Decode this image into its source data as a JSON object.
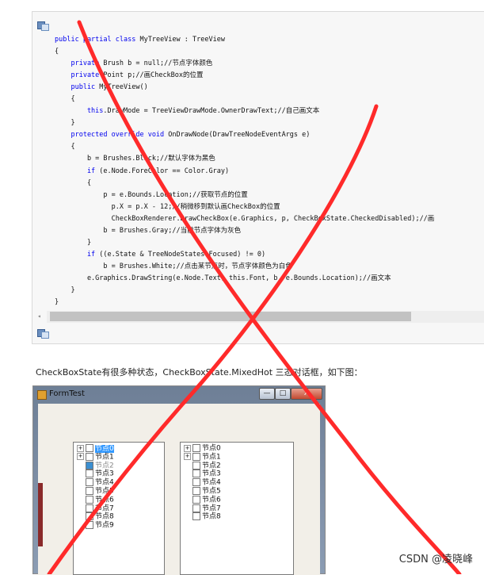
{
  "code_lines": [
    {
      "kw": "public partial class",
      "rest": " MyTreeView : TreeView"
    },
    {
      "kw": "",
      "rest": "{"
    },
    {
      "kw": "    private",
      "rest": " Brush b = null;//节点字体颜色"
    },
    {
      "kw": "    private",
      "rest": " Point p;//画CheckBox的位置"
    },
    {
      "kw": "    public",
      "rest": " MyTreeView()"
    },
    {
      "kw": "",
      "rest": "    {"
    },
    {
      "kw": "        this",
      "rest": ".DrawMode = TreeViewDrawMode.OwnerDrawText;//自己画文本"
    },
    {
      "kw": "",
      "rest": "    }"
    },
    {
      "kw": "    protected override void",
      "rest": " OnDrawNode(DrawTreeNodeEventArgs e)"
    },
    {
      "kw": "",
      "rest": "    {"
    },
    {
      "kw": "",
      "rest": "        b = Brushes.Black;//默认字体为黑色"
    },
    {
      "kw": "        if",
      "rest": " (e.Node.ForeColor == Color.Gray)"
    },
    {
      "kw": "",
      "rest": "        {"
    },
    {
      "kw": "",
      "rest": "            p = e.Bounds.Location;//获取节点的位置"
    },
    {
      "kw": "",
      "rest": "              p.X = p.X - 12;//稍微移到默认画CheckBox的位置"
    },
    {
      "kw": "",
      "rest": "              CheckBoxRenderer.DrawCheckBox(e.Graphics, p, CheckBoxState.CheckedDisabled);//画"
    },
    {
      "kw": "",
      "rest": "            b = Brushes.Gray;//当前节点字体为灰色"
    },
    {
      "kw": "",
      "rest": "        }"
    },
    {
      "kw": "        if",
      "rest": " ((e.State & TreeNodeStates.Focused) != 0)"
    },
    {
      "kw": "",
      "rest": "            b = Brushes.White;//点击某节点时，节点字体颜色为白色"
    },
    {
      "kw": "",
      "rest": "        e.Graphics.DrawString(e.Node.Text, this.Font, b, e.Bounds.Location);//画文本"
    },
    {
      "kw": "",
      "rest": "    }"
    },
    {
      "kw": "",
      "rest": "}"
    }
  ],
  "caption": "CheckBoxState有很多种状态，CheckBoxState.MixedHot 三态对话框，如下图：",
  "window": {
    "title": "FormTest",
    "btn_min": "—",
    "btn_max": "□",
    "btn_close": "X"
  },
  "tree_left": [
    {
      "label": "节点0",
      "expander": "+",
      "selected": true,
      "gray": false,
      "mixed": false
    },
    {
      "label": "节点1",
      "expander": "+",
      "selected": false,
      "gray": false,
      "mixed": false
    },
    {
      "label": "节点2",
      "expander": "",
      "selected": false,
      "gray": true,
      "mixed": true
    },
    {
      "label": "节点3",
      "expander": "",
      "selected": false,
      "gray": false,
      "mixed": false
    },
    {
      "label": "节点4",
      "expander": "",
      "selected": false,
      "gray": false,
      "mixed": false
    },
    {
      "label": "节点5",
      "expander": "",
      "selected": false,
      "gray": false,
      "mixed": false
    },
    {
      "label": "节点6",
      "expander": "",
      "selected": false,
      "gray": false,
      "mixed": false
    },
    {
      "label": "节点7",
      "expander": "",
      "selected": false,
      "gray": false,
      "mixed": false
    },
    {
      "label": "节点8",
      "expander": "",
      "selected": false,
      "gray": false,
      "mixed": false
    },
    {
      "label": "节点9",
      "expander": "",
      "selected": false,
      "gray": false,
      "mixed": false
    }
  ],
  "tree_right": [
    {
      "label": "节点0",
      "expander": "+"
    },
    {
      "label": "节点1",
      "expander": "+"
    },
    {
      "label": "节点2",
      "expander": ""
    },
    {
      "label": "节点3",
      "expander": ""
    },
    {
      "label": "节点4",
      "expander": ""
    },
    {
      "label": "节点5",
      "expander": ""
    },
    {
      "label": "节点6",
      "expander": ""
    },
    {
      "label": "节点7",
      "expander": ""
    },
    {
      "label": "节点8",
      "expander": ""
    }
  ],
  "watermark": "CSDN @凌晓峰",
  "colors": {
    "keyword": "#0000ee",
    "cross": "#ff2a2a",
    "selection": "#3399ff"
  }
}
